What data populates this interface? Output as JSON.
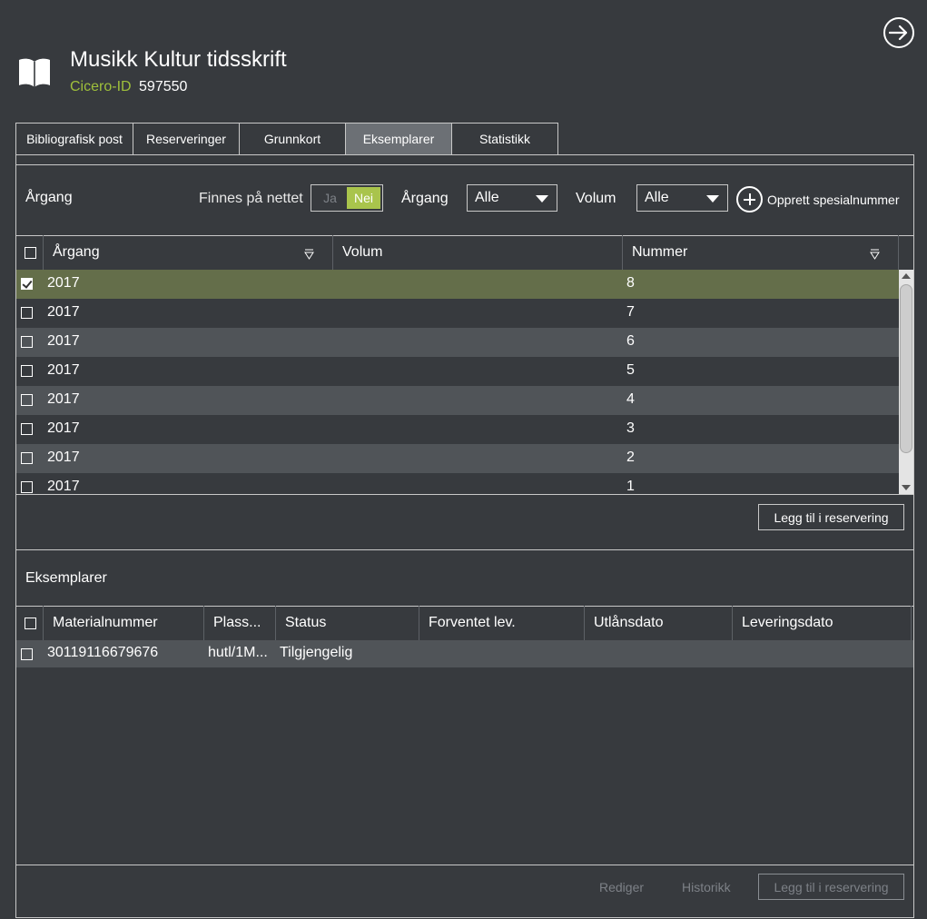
{
  "header": {
    "title": "Musikk Kultur tidsskrift",
    "id_label": "Cicero-ID",
    "id_value": "597550"
  },
  "tabs": [
    {
      "label": "Bibliografisk post"
    },
    {
      "label": "Reserveringer"
    },
    {
      "label": "Grunnkort"
    },
    {
      "label": "Eksemplarer",
      "active": true
    },
    {
      "label": "Statistikk"
    }
  ],
  "filters": {
    "section_title": "Årgang",
    "online_label": "Finnes på nettet",
    "toggle_yes": "Ja",
    "toggle_no": "Nei",
    "toggle_selected": "Nei",
    "argang_label": "Årgang",
    "argang_value": "Alle",
    "volum_label": "Volum",
    "volum_value": "Alle",
    "special_label": "Opprett spesialnummer"
  },
  "issues_table": {
    "columns": [
      "Årgang",
      "Volum",
      "Nummer"
    ],
    "rows": [
      {
        "argang": "2017",
        "volum": "",
        "nummer": "8",
        "checked": true
      },
      {
        "argang": "2017",
        "volum": "",
        "nummer": "7",
        "checked": false
      },
      {
        "argang": "2017",
        "volum": "",
        "nummer": "6",
        "checked": false
      },
      {
        "argang": "2017",
        "volum": "",
        "nummer": "5",
        "checked": false
      },
      {
        "argang": "2017",
        "volum": "",
        "nummer": "4",
        "checked": false
      },
      {
        "argang": "2017",
        "volum": "",
        "nummer": "3",
        "checked": false
      },
      {
        "argang": "2017",
        "volum": "",
        "nummer": "2",
        "checked": false
      },
      {
        "argang": "2017",
        "volum": "",
        "nummer": "1",
        "checked": false
      }
    ],
    "reserve_button": "Legg til i reservering"
  },
  "copies": {
    "title": "Eksemplarer",
    "columns": [
      "Materialnummer",
      "Plass...",
      "Status",
      "Forventet lev.",
      "Utlånsdato",
      "Leveringsdato"
    ],
    "rows": [
      {
        "materialnummer": "30119116679676",
        "plass": "hutl/1M...",
        "status": "Tilgjengelig",
        "forventet": "",
        "utlan": "",
        "levering": ""
      }
    ]
  },
  "footer": {
    "edit": "Rediger",
    "history": "Historikk",
    "reserve": "Legg til i reservering"
  },
  "colors": {
    "background": "#373a3e",
    "accent_green": "#9fc03b",
    "toggle_on": "#a9c44c",
    "selected_row": "#646e4a",
    "active_tab": "#6c7075"
  }
}
